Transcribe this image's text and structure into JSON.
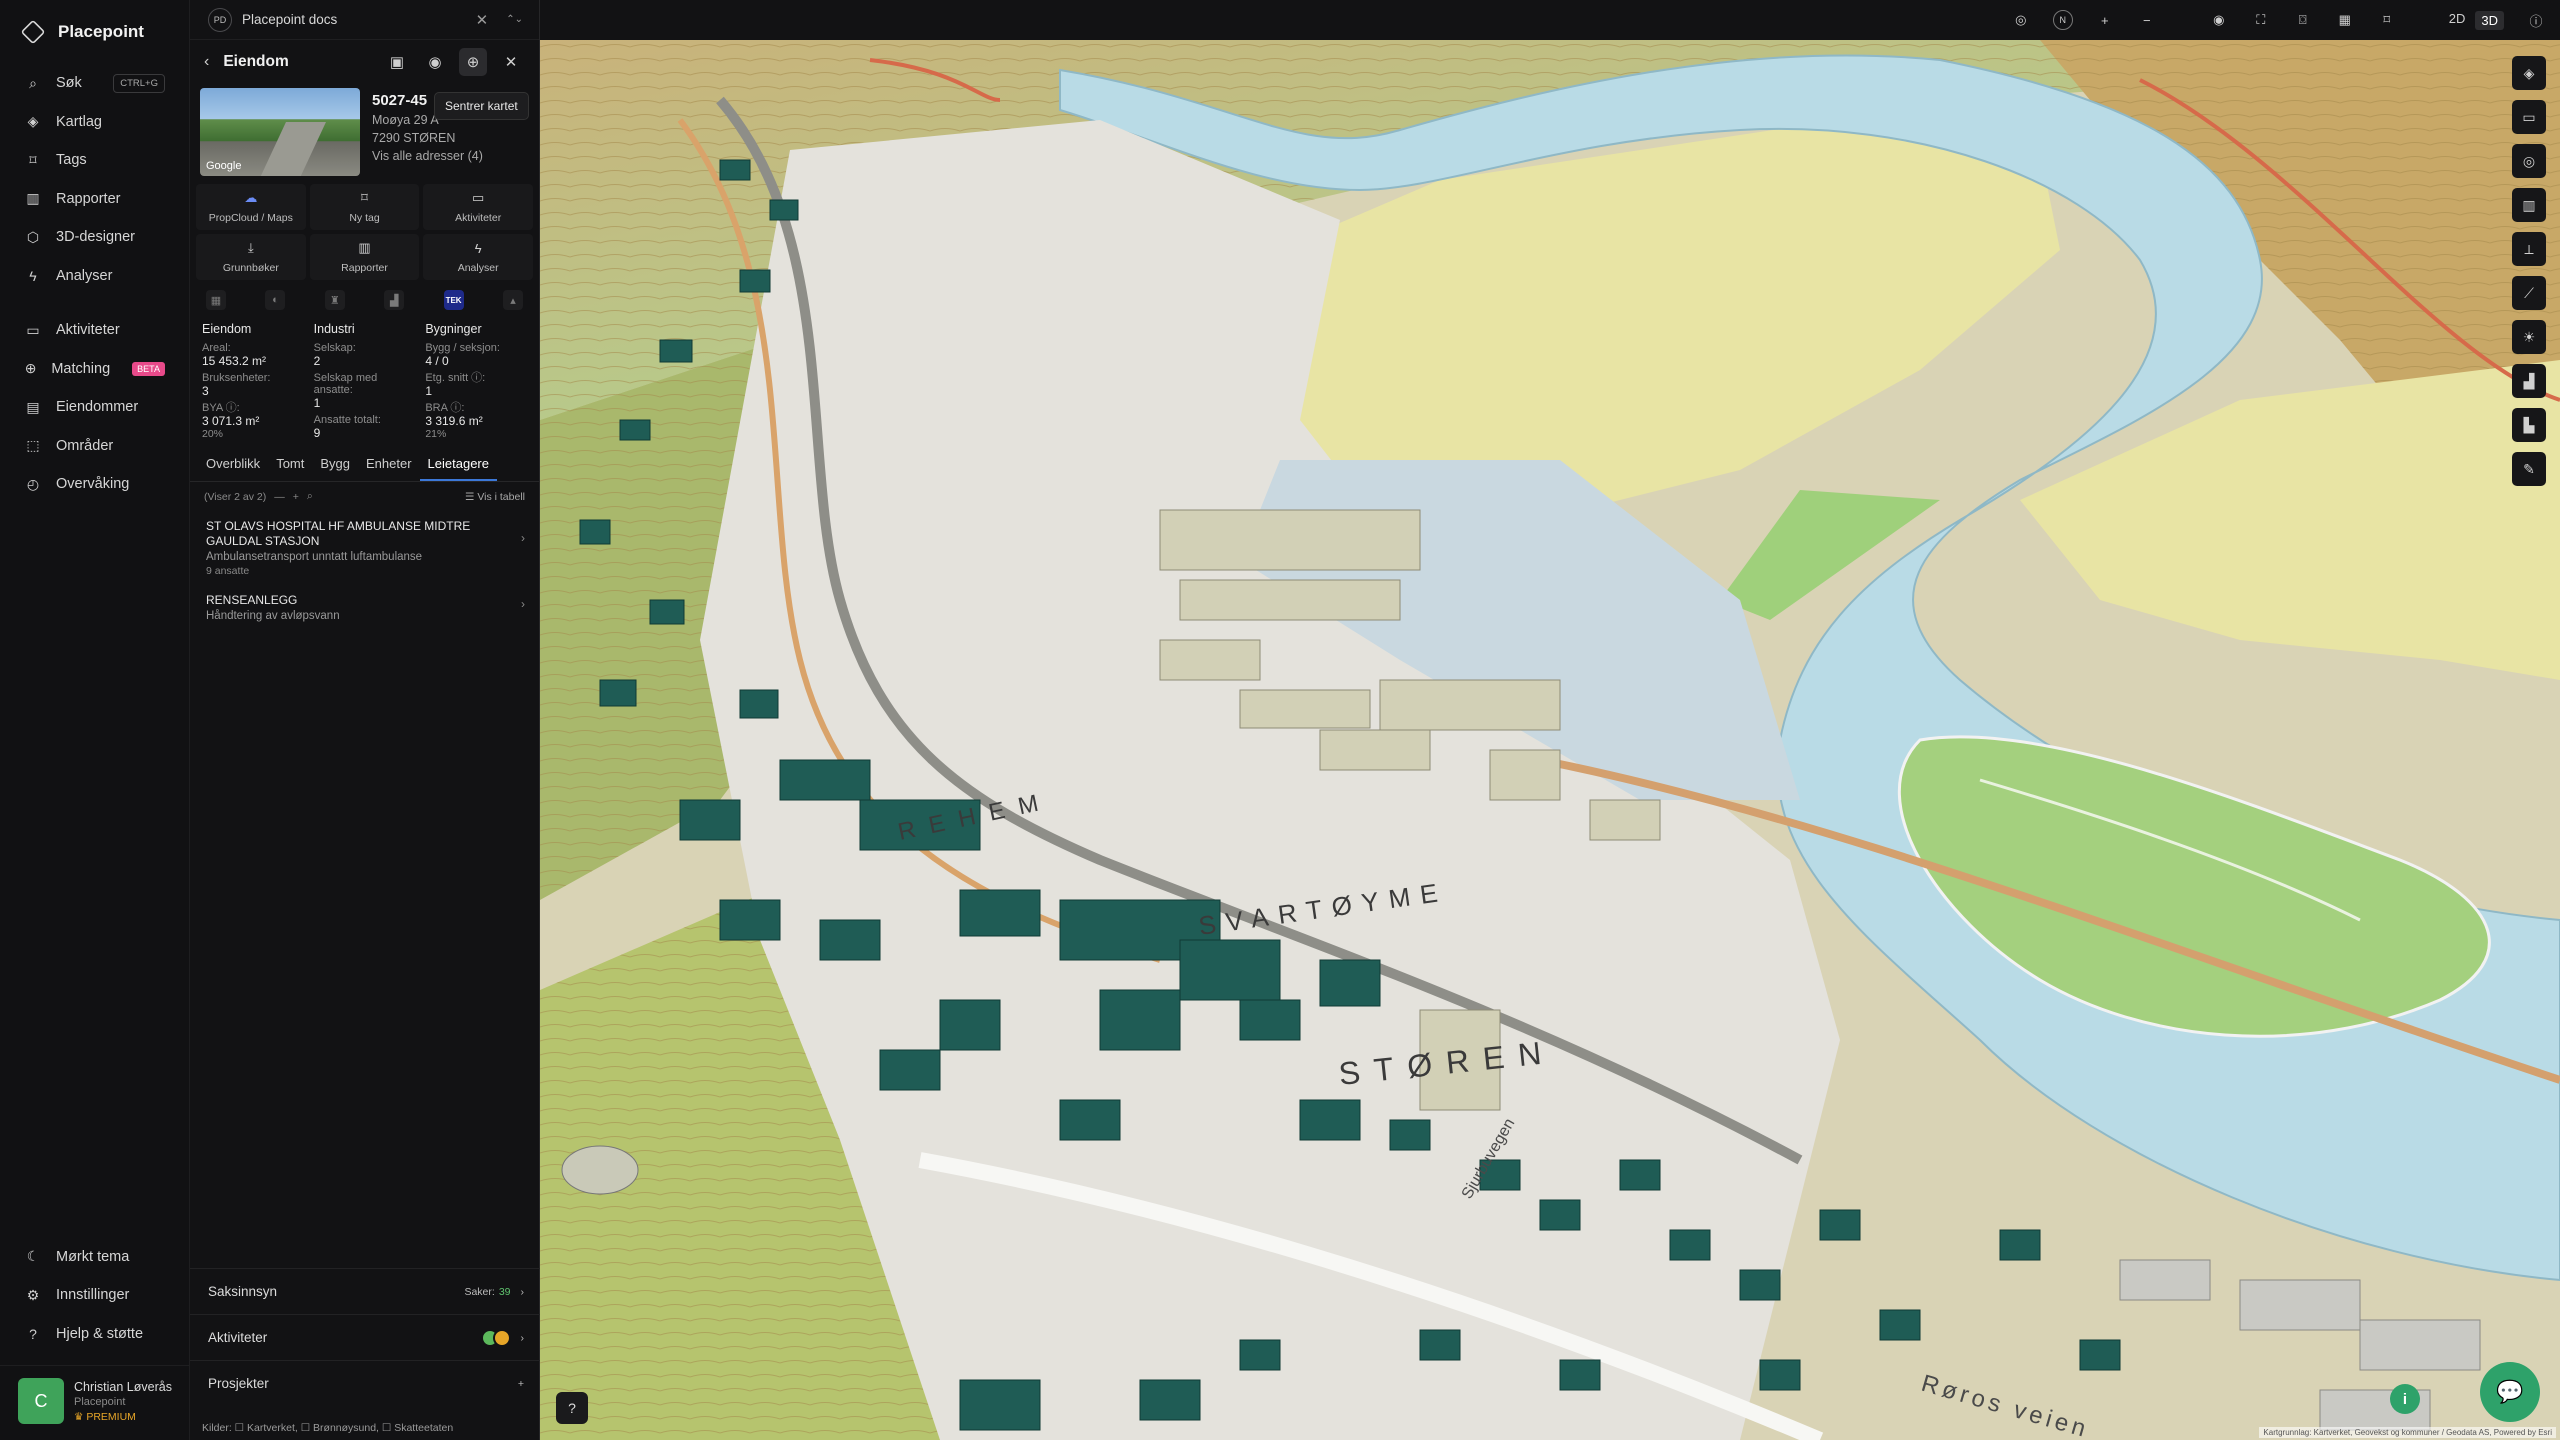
{
  "app": {
    "name": "Placepoint"
  },
  "nav": {
    "items": [
      {
        "icon": "search-icon",
        "label": "Søk",
        "shortcut": "CTRL+G"
      },
      {
        "icon": "layers-icon",
        "label": "Kartlag"
      },
      {
        "icon": "bookmark-icon",
        "label": "Tags"
      },
      {
        "icon": "bar-chart-icon",
        "label": "Rapporter"
      },
      {
        "icon": "cube-icon",
        "label": "3D-designer"
      },
      {
        "icon": "bolt-icon",
        "label": "Analyser"
      }
    ],
    "items2": [
      {
        "icon": "chat-icon",
        "label": "Aktiviteter"
      },
      {
        "icon": "search-match-icon",
        "label": "Matching",
        "badge": "BETA"
      },
      {
        "icon": "document-icon",
        "label": "Eiendommer"
      },
      {
        "icon": "dashed-square-icon",
        "label": "Områder"
      },
      {
        "icon": "monitor-icon",
        "label": "Overvåking"
      }
    ],
    "bottom": [
      {
        "icon": "moon-icon",
        "label": "Mørkt tema"
      },
      {
        "icon": "gear-icon",
        "label": "Innstillinger"
      },
      {
        "icon": "help-icon",
        "label": "Hjelp & støtte"
      }
    ],
    "user": {
      "initial": "C",
      "name": "Christian Løverås",
      "org": "Placepoint",
      "plan": "PREMIUM"
    }
  },
  "panel": {
    "workspace": {
      "badge": "PD",
      "name": "Placepoint docs"
    },
    "header": {
      "title": "Eiendom",
      "tooltip": "Sentrer kartet"
    },
    "property": {
      "id": "5027-45",
      "address": "Moøya 29 A",
      "postal": "7290 STØREN",
      "all_addresses": "Vis alle adresser (4)",
      "thumb_label": "Google"
    },
    "actions": [
      {
        "icon": "cloud-icon",
        "label": "PropCloud / Maps"
      },
      {
        "icon": "bookmark-icon",
        "label": "Ny tag"
      },
      {
        "icon": "chat-icon",
        "label": "Aktiviteter"
      },
      {
        "icon": "download-icon",
        "label": "Grunnbøker"
      },
      {
        "icon": "bar-chart-icon",
        "label": "Rapporter"
      },
      {
        "icon": "bolt-icon",
        "label": "Analyser"
      }
    ],
    "badge_tek": "TEK",
    "stats": {
      "col1": {
        "title": "Eiendom",
        "k1": "Areal:",
        "v1": "15 453.2 m²",
        "k2": "Bruksenheter:",
        "v2": "3",
        "k3": "BYA ⓘ:",
        "v3": "3 071.3 m²",
        "p3": "20%"
      },
      "col2": {
        "title": "Industri",
        "k1": "Selskap:",
        "v1": "2",
        "k2": "Selskap med ansatte:",
        "v2": "1",
        "k3": "Ansatte totalt:",
        "v3": "9"
      },
      "col3": {
        "title": "Bygninger",
        "k1": "Bygg / seksjon:",
        "v1": "4 / 0",
        "k2": "Etg. snitt ⓘ:",
        "v2": "1",
        "k3": "BRA ⓘ:",
        "v3": "3 319.6 m²",
        "p3": "21%"
      }
    },
    "tabs": [
      "Overblikk",
      "Tomt",
      "Bygg",
      "Enheter",
      "Leietagere"
    ],
    "active_tab": "Leietagere",
    "list": {
      "count": "(Viser 2 av 2)",
      "toggle": "Vis i tabell"
    },
    "tenants": [
      {
        "name": "ST OLAVS HOSPITAL HF AMBULANSE MIDTRE GAULDAL STASJON",
        "desc": "Ambulansetransport unntatt luftambulanse",
        "emp": "9 ansatte"
      },
      {
        "name": "RENSEANLEGG",
        "desc": "Håndtering av avløpsvann",
        "emp": ""
      }
    ],
    "sections": {
      "saksinnsyn": "Saksinnsyn",
      "saker_label": "Saker:",
      "saker_count": "39",
      "aktiviteter": "Aktiviteter",
      "prosjekter": "Prosjekter"
    },
    "sources": "Kilder: ☐ Kartverket, ☐ Brønnøysund, ☐ Skatteetaten"
  },
  "map": {
    "mode_2d": "2D",
    "mode_3d": "3D",
    "active_mode": "3D",
    "labels": [
      "STØREN",
      "SVARTØYME",
      "REHEM",
      "Røros veien",
      "Sjurbuvegen"
    ],
    "attribution": "Kartgrunnlag: Kartverket, Geovekst og kommuner / Geodata AS, Powered by Esri",
    "colors": {
      "water": "#b9dbe6",
      "field": "#e6e3a0",
      "grass": "#9ccf7b",
      "building": "#1f5c55",
      "terrain": "#d8c9a0"
    }
  }
}
